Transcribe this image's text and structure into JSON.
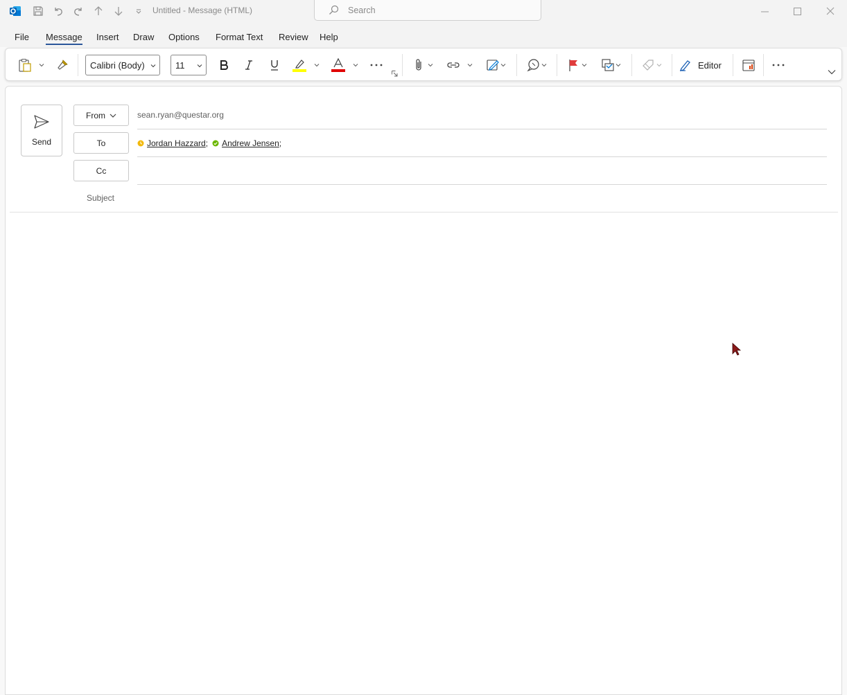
{
  "window": {
    "title": "Untitled  -  Message (HTML)",
    "search_placeholder": "Search"
  },
  "menu": {
    "tabs": [
      {
        "label": "File"
      },
      {
        "label": "Message",
        "active": true
      },
      {
        "label": "Insert"
      },
      {
        "label": "Draw"
      },
      {
        "label": "Options"
      },
      {
        "label": "Format Text"
      },
      {
        "label": "Review"
      },
      {
        "label": "Help"
      }
    ]
  },
  "ribbon": {
    "font_name": "Calibri (Body)",
    "font_size": "11",
    "editor_label": "Editor",
    "highlight_color": "#ffff00",
    "font_color": "#e00000",
    "flag_color": "#e03c3c"
  },
  "compose": {
    "send_label": "Send",
    "from_label": "From",
    "from_address": "sean.ryan@questar.org",
    "to_label": "To",
    "cc_label": "Cc",
    "subject_label": "Subject",
    "recipients": [
      {
        "name": "Jordan Hazzard",
        "separator": ";",
        "status": "away",
        "status_color": "#f2b90c"
      },
      {
        "name": "Andrew Jensen",
        "separator": ";",
        "status": "available",
        "status_color": "#6bb700"
      }
    ]
  },
  "colors": {
    "accent": "#2b579a",
    "outlook_blue": "#0364b8"
  }
}
